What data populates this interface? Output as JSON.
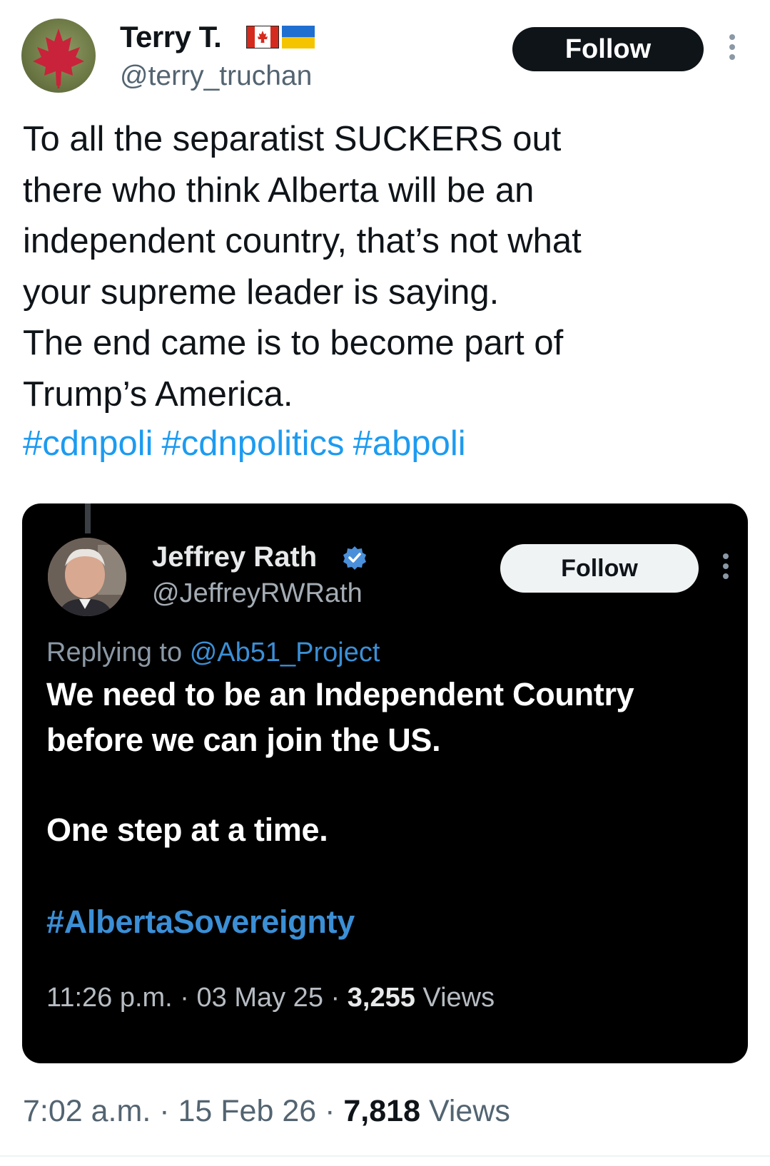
{
  "tweet": {
    "author": {
      "display_name": "Terry T.",
      "handle": "@terry_truchan",
      "flags": [
        "canada-flag",
        "ukraine-flag"
      ],
      "avatar_icon": "maple-leaf-avatar"
    },
    "follow_label": "Follow",
    "more_icon": "more-vertical-icon",
    "text_lines": [
      "To all the separatist SUCKERS out",
      "there who think Alberta will be an",
      "independent country, that’s not what",
      "your supreme leader is saying.",
      "The end came is to become part of",
      "Trump’s America."
    ],
    "hashtags": [
      "#cdnpoli",
      "#cdnpolitics",
      "#abpoli"
    ],
    "meta": {
      "time": "7:02 a.m.",
      "sep1": "·",
      "date": "15 Feb 26",
      "sep2": "·",
      "views_count": "7,818",
      "views_label": "Views"
    }
  },
  "quoted_tweet": {
    "author": {
      "display_name": "Jeffrey Rath",
      "handle": "@JeffreyRWRath",
      "verified_icon": "verified-badge-icon"
    },
    "follow_label": "Follow",
    "replying_prefix": "Replying to",
    "replying_to": "@Ab51_Project",
    "text_line1": "We need to be an Independent Country",
    "text_line2": "before we can join the US.",
    "text_line3": "One step at a time.",
    "hashtag": "#AlbertaSovereignty",
    "meta": {
      "time": "11:26 p.m.",
      "sep1": "·",
      "date": "03 May 25",
      "sep2": "·",
      "views_count": "3,255",
      "views_label": "Views"
    }
  },
  "colors": {
    "link_blue": "#1d9bf0",
    "quote_link_blue": "#3b8fd6",
    "text_dark": "#0f1419",
    "text_grey": "#536471",
    "quote_bg": "#000000"
  }
}
